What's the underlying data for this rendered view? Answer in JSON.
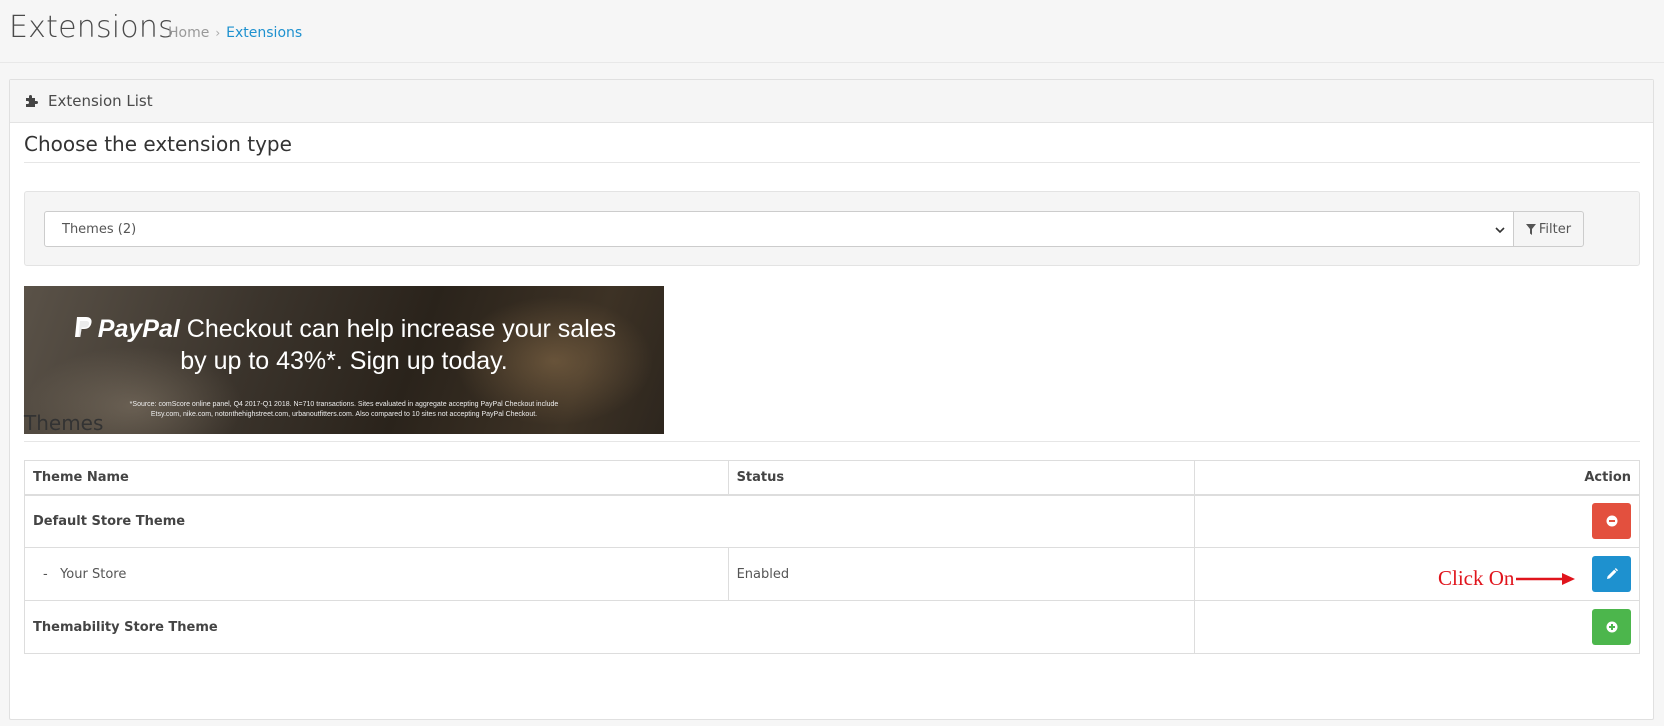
{
  "header": {
    "title": "Extensions",
    "breadcrumb": [
      {
        "label": "Home"
      },
      {
        "label": "Extensions"
      }
    ]
  },
  "panel": {
    "title": "Extension List",
    "choose_heading": "Choose the extension type",
    "select_value": "Themes (2)",
    "filter_label": "Filter"
  },
  "banner": {
    "brand": "PayPal",
    "headline_1": "Checkout can help increase your sales",
    "headline_2": "by up to 43%*. Sign up today.",
    "fineprint_1": "*Source: comScore online panel, Q4 2017-Q1 2018. N=710 transactions. Sites evaluated in aggregate accepting PayPal Checkout include",
    "fineprint_2": "Etsy.com, nike.com, notonthehighstreet.com, urbanoutfitters.com. Also compared to 10 sites not accepting PayPal Checkout."
  },
  "themes": {
    "heading": "Themes",
    "columns": {
      "name": "Theme Name",
      "status": "Status",
      "action": "Action"
    },
    "rows": [
      {
        "name": "Default Store Theme",
        "action": "uninstall"
      },
      {
        "name": "-   Your Store",
        "status": "Enabled",
        "action": "edit"
      },
      {
        "name": "Themability Store Theme",
        "action": "install"
      }
    ]
  },
  "annotation": {
    "text": "Click On"
  },
  "colors": {
    "link": "#1e91cf",
    "danger": "#e3503e",
    "primary": "#1e91cf",
    "success": "#4cb64c",
    "annotation": "#e0141c"
  }
}
